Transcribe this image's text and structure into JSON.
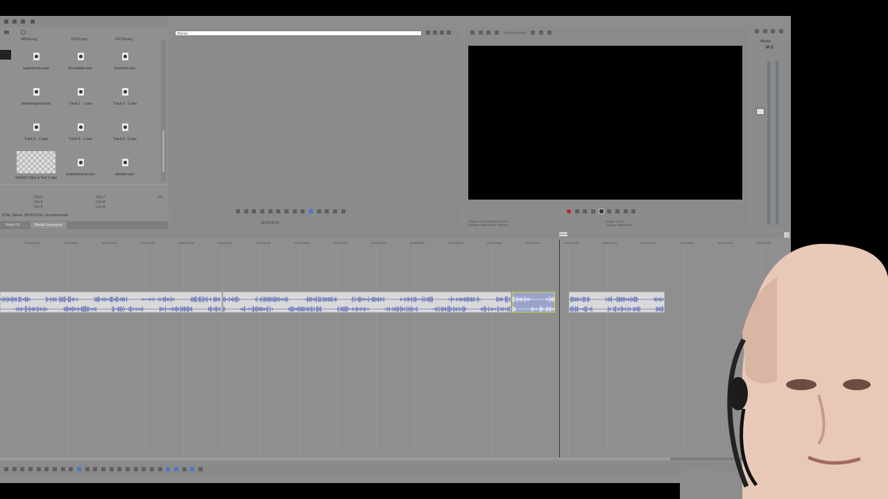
{
  "explorer": {
    "items": [
      {
        "label": "superheroes.wav"
      },
      {
        "label": "theoutdoor.wav"
      },
      {
        "label": "therefore.wav"
      },
      {
        "label": "theyweregood.wav"
      },
      {
        "label": "Track 1 - 1.wav"
      },
      {
        "label": "Track 3 - 1.wav"
      },
      {
        "label": "Track 6 - 1.wav"
      },
      {
        "label": "Track 8 - 1.wav"
      },
      {
        "label": "Track 9 - 2.wav"
      },
      {
        "label": "VEGAS Titles & Text 1.wav"
      },
      {
        "label": "whatshename.wav"
      },
      {
        "label": "whether.wav"
      }
    ],
    "top_labels": [
      "04054.png",
      "15314.png",
      "10174l.png"
    ],
    "info_text": "16 Bit, Stereo, 00:00:53.03, Uncompressed",
    "shortcuts": [
      [
        "Ctrl+4",
        "Ctrl+7",
        "Ctl"
      ],
      [
        "Ctrl+5",
        "Ctrl+8"
      ],
      [
        "Ctrl+6",
        "Ctrl+9"
      ]
    ],
    "tabs": [
      "Video FX",
      "Media Generators"
    ]
  },
  "trimmer": {
    "source": "(None)",
    "time": "00:00:00;00"
  },
  "preview": {
    "quality": "Preview (Auto)",
    "project_info": "Project: 1920x1080x32, 29.970i",
    "preview_info": "Preview: 480x270x32, 29.970p",
    "frame_info": "Frame: 18,797",
    "display_info": "Display: 394x222x32"
  },
  "mixer": {
    "title": "Master",
    "ms": "M S"
  },
  "timeline": {
    "ruler_labels": [
      "00:00:00;00",
      "00:00:05;00",
      "00:00:10;00",
      "00:00:15;00",
      "00:00:20;00",
      "00:00:25;00",
      "00:00:30;00",
      "00:00:35;00",
      "00:00:40;00",
      "00:00:45;00",
      "00:00:50;00",
      "00:00:55;00",
      "00:01:00;00",
      "00:01:05;00",
      "00:01:10;00",
      "00:01:15;00",
      "00:01:20;00",
      "00:01:25;00",
      "00:01:30;00",
      "00:01:35;00"
    ],
    "cursor_time": "3:41:22"
  },
  "colors": {
    "app_bg": "#8d8d8d",
    "clip_bg": "#d9d9d9",
    "waveform": "#5a66b4",
    "selected_border": "#c9d438"
  }
}
